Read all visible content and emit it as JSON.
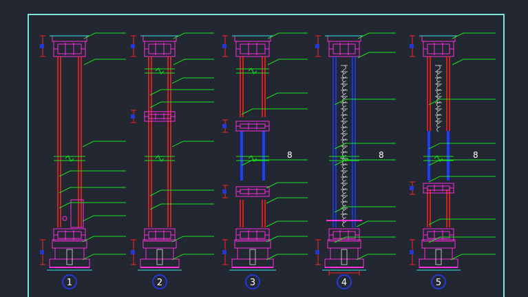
{
  "colors": {
    "background": "#222732",
    "frame": "#7fe7d4",
    "profile": "#ff2ee0",
    "mullion_red": "#ff2020",
    "glass_blue": "#1a3dff",
    "leader_green": "#19e619",
    "dimension_blue": "#2238d8",
    "hatch_grey": "#bcbcbc",
    "cyan": "#33e6e6",
    "label_white": "#ffffff"
  },
  "sections": [
    {
      "id": "1",
      "number_label": "1",
      "callout_label": ""
    },
    {
      "id": "2",
      "number_label": "2",
      "callout_label": ""
    },
    {
      "id": "3",
      "number_label": "3",
      "callout_label": "8"
    },
    {
      "id": "4",
      "number_label": "4",
      "callout_label": "8"
    },
    {
      "id": "5",
      "number_label": "5",
      "callout_label": "8"
    }
  ]
}
